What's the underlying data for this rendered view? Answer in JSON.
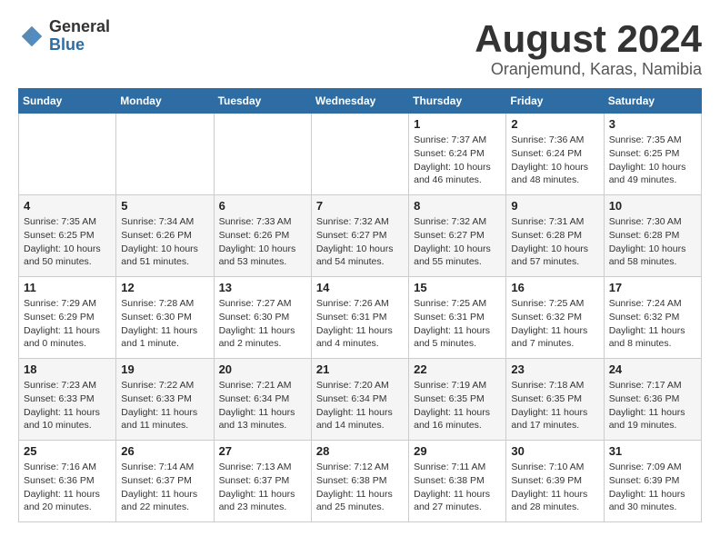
{
  "header": {
    "logo_general": "General",
    "logo_blue": "Blue",
    "title": "August 2024",
    "subtitle": "Oranjemund, Karas, Namibia"
  },
  "weekdays": [
    "Sunday",
    "Monday",
    "Tuesday",
    "Wednesday",
    "Thursday",
    "Friday",
    "Saturday"
  ],
  "weeks": [
    [
      {
        "day": "",
        "info": ""
      },
      {
        "day": "",
        "info": ""
      },
      {
        "day": "",
        "info": ""
      },
      {
        "day": "",
        "info": ""
      },
      {
        "day": "1",
        "info": "Sunrise: 7:37 AM\nSunset: 6:24 PM\nDaylight: 10 hours\nand 46 minutes."
      },
      {
        "day": "2",
        "info": "Sunrise: 7:36 AM\nSunset: 6:24 PM\nDaylight: 10 hours\nand 48 minutes."
      },
      {
        "day": "3",
        "info": "Sunrise: 7:35 AM\nSunset: 6:25 PM\nDaylight: 10 hours\nand 49 minutes."
      }
    ],
    [
      {
        "day": "4",
        "info": "Sunrise: 7:35 AM\nSunset: 6:25 PM\nDaylight: 10 hours\nand 50 minutes."
      },
      {
        "day": "5",
        "info": "Sunrise: 7:34 AM\nSunset: 6:26 PM\nDaylight: 10 hours\nand 51 minutes."
      },
      {
        "day": "6",
        "info": "Sunrise: 7:33 AM\nSunset: 6:26 PM\nDaylight: 10 hours\nand 53 minutes."
      },
      {
        "day": "7",
        "info": "Sunrise: 7:32 AM\nSunset: 6:27 PM\nDaylight: 10 hours\nand 54 minutes."
      },
      {
        "day": "8",
        "info": "Sunrise: 7:32 AM\nSunset: 6:27 PM\nDaylight: 10 hours\nand 55 minutes."
      },
      {
        "day": "9",
        "info": "Sunrise: 7:31 AM\nSunset: 6:28 PM\nDaylight: 10 hours\nand 57 minutes."
      },
      {
        "day": "10",
        "info": "Sunrise: 7:30 AM\nSunset: 6:28 PM\nDaylight: 10 hours\nand 58 minutes."
      }
    ],
    [
      {
        "day": "11",
        "info": "Sunrise: 7:29 AM\nSunset: 6:29 PM\nDaylight: 11 hours\nand 0 minutes."
      },
      {
        "day": "12",
        "info": "Sunrise: 7:28 AM\nSunset: 6:30 PM\nDaylight: 11 hours\nand 1 minute."
      },
      {
        "day": "13",
        "info": "Sunrise: 7:27 AM\nSunset: 6:30 PM\nDaylight: 11 hours\nand 2 minutes."
      },
      {
        "day": "14",
        "info": "Sunrise: 7:26 AM\nSunset: 6:31 PM\nDaylight: 11 hours\nand 4 minutes."
      },
      {
        "day": "15",
        "info": "Sunrise: 7:25 AM\nSunset: 6:31 PM\nDaylight: 11 hours\nand 5 minutes."
      },
      {
        "day": "16",
        "info": "Sunrise: 7:25 AM\nSunset: 6:32 PM\nDaylight: 11 hours\nand 7 minutes."
      },
      {
        "day": "17",
        "info": "Sunrise: 7:24 AM\nSunset: 6:32 PM\nDaylight: 11 hours\nand 8 minutes."
      }
    ],
    [
      {
        "day": "18",
        "info": "Sunrise: 7:23 AM\nSunset: 6:33 PM\nDaylight: 11 hours\nand 10 minutes."
      },
      {
        "day": "19",
        "info": "Sunrise: 7:22 AM\nSunset: 6:33 PM\nDaylight: 11 hours\nand 11 minutes."
      },
      {
        "day": "20",
        "info": "Sunrise: 7:21 AM\nSunset: 6:34 PM\nDaylight: 11 hours\nand 13 minutes."
      },
      {
        "day": "21",
        "info": "Sunrise: 7:20 AM\nSunset: 6:34 PM\nDaylight: 11 hours\nand 14 minutes."
      },
      {
        "day": "22",
        "info": "Sunrise: 7:19 AM\nSunset: 6:35 PM\nDaylight: 11 hours\nand 16 minutes."
      },
      {
        "day": "23",
        "info": "Sunrise: 7:18 AM\nSunset: 6:35 PM\nDaylight: 11 hours\nand 17 minutes."
      },
      {
        "day": "24",
        "info": "Sunrise: 7:17 AM\nSunset: 6:36 PM\nDaylight: 11 hours\nand 19 minutes."
      }
    ],
    [
      {
        "day": "25",
        "info": "Sunrise: 7:16 AM\nSunset: 6:36 PM\nDaylight: 11 hours\nand 20 minutes."
      },
      {
        "day": "26",
        "info": "Sunrise: 7:14 AM\nSunset: 6:37 PM\nDaylight: 11 hours\nand 22 minutes."
      },
      {
        "day": "27",
        "info": "Sunrise: 7:13 AM\nSunset: 6:37 PM\nDaylight: 11 hours\nand 23 minutes."
      },
      {
        "day": "28",
        "info": "Sunrise: 7:12 AM\nSunset: 6:38 PM\nDaylight: 11 hours\nand 25 minutes."
      },
      {
        "day": "29",
        "info": "Sunrise: 7:11 AM\nSunset: 6:38 PM\nDaylight: 11 hours\nand 27 minutes."
      },
      {
        "day": "30",
        "info": "Sunrise: 7:10 AM\nSunset: 6:39 PM\nDaylight: 11 hours\nand 28 minutes."
      },
      {
        "day": "31",
        "info": "Sunrise: 7:09 AM\nSunset: 6:39 PM\nDaylight: 11 hours\nand 30 minutes."
      }
    ]
  ]
}
